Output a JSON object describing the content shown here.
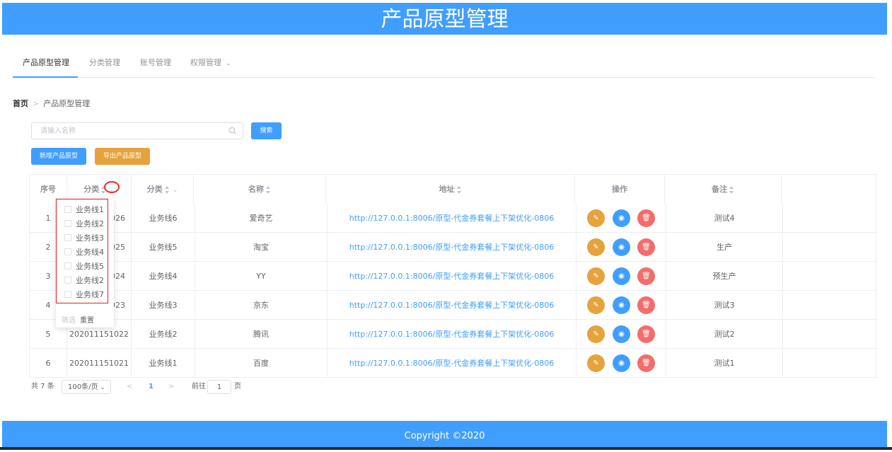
{
  "header": {
    "title": "产品原型管理"
  },
  "nav": {
    "tabs": [
      "产品原型管理",
      "分类管理",
      "账号管理",
      "权限管理"
    ]
  },
  "breadcrumb": {
    "home": "首页",
    "current": "产品原型管理"
  },
  "search": {
    "placeholder": "请输入名称",
    "button": "搜索"
  },
  "actions": {
    "add": "新增产品原型",
    "export": "导出产品原型"
  },
  "table": {
    "columns": [
      "序号",
      "分类",
      "分类",
      "名称",
      "地址",
      "操作",
      "备注"
    ],
    "rows": [
      {
        "index": "1",
        "code": "026",
        "category": "业务线6",
        "name": "爱奇艺",
        "url": "http://127.0.0.1:8006/原型-代金券套餐上下架优化-0806",
        "note": "测试4"
      },
      {
        "index": "2",
        "code": "025",
        "category": "业务线5",
        "name": "淘宝",
        "url": "http://127.0.0.1:8006/原型-代金券套餐上下架优化-0806",
        "note": "生产"
      },
      {
        "index": "3",
        "code": "024",
        "category": "业务线4",
        "name": "YY",
        "url": "http://127.0.0.1:8006/原型-代金券套餐上下架优化-0806",
        "note": "预生产"
      },
      {
        "index": "4",
        "code": "023",
        "category": "业务线3",
        "name": "京东",
        "url": "http://127.0.0.1:8006/原型-代金券套餐上下架优化-0806",
        "note": "测试3"
      },
      {
        "index": "5",
        "code": "202011151022",
        "category": "业务线2",
        "name": "腾讯",
        "url": "http://127.0.0.1:8006/原型-代金券套餐上下架优化-0806",
        "note": "测试2"
      },
      {
        "index": "6",
        "code": "202011151021",
        "category": "业务线1",
        "name": "百度",
        "url": "http://127.0.0.1:8006/原型-代金券套餐上下架优化-0806",
        "note": "测试1"
      }
    ]
  },
  "filter": {
    "options": [
      "业务线1",
      "业务线2",
      "业务线3",
      "业务线4",
      "业务线5",
      "业务线2",
      "业务线7"
    ],
    "confirm": "筛选",
    "reset": "重置"
  },
  "pagination": {
    "total": "共 7 条",
    "page_size": "100条/页",
    "current_page": "1",
    "goto_label": "前往",
    "goto_value": "1",
    "page_unit": "页"
  },
  "footer": {
    "copyright": "Copyright ©2020"
  }
}
